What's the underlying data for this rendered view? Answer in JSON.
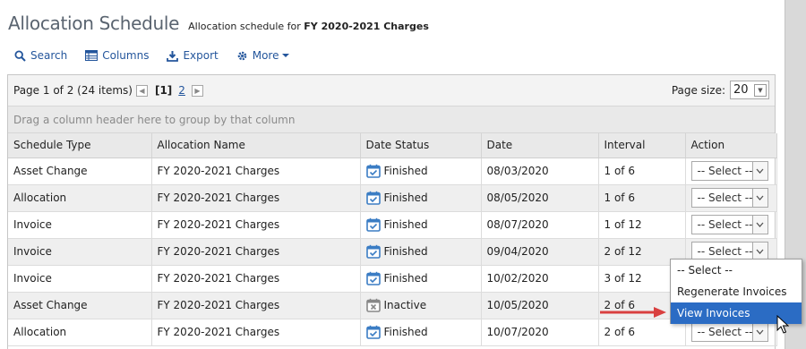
{
  "header": {
    "title": "Allocation Schedule",
    "subtitle_prefix": "Allocation schedule for",
    "subtitle_bold": "FY 2020-2021 Charges"
  },
  "toolbar": {
    "search": "Search",
    "columns": "Columns",
    "export": "Export",
    "more": "More"
  },
  "pager": {
    "info": "Page 1 of 2 (24 items)",
    "current": "[1]",
    "next": "2",
    "page_size_label": "Page size:",
    "page_size": "20"
  },
  "group_panel_text": "Drag a column header here to group by that column",
  "columns": [
    "Schedule Type",
    "Allocation Name",
    "Date Status",
    "Date",
    "Interval",
    "Action"
  ],
  "rows": [
    {
      "type": "Asset Change",
      "name": "FY 2020-2021 Charges",
      "status": "Finished",
      "status_icon": "calendar-check-icon",
      "date": "08/03/2020",
      "interval": "1 of 6",
      "action": "-- Select --"
    },
    {
      "type": "Allocation",
      "name": "FY 2020-2021 Charges",
      "status": "Finished",
      "status_icon": "calendar-check-icon",
      "date": "08/05/2020",
      "interval": "1 of 6",
      "action": "-- Select --"
    },
    {
      "type": "Invoice",
      "name": "FY 2020-2021 Charges",
      "status": "Finished",
      "status_icon": "calendar-check-icon",
      "date": "08/07/2020",
      "interval": "1 of 12",
      "action": "-- Select --"
    },
    {
      "type": "Invoice",
      "name": "FY 2020-2021 Charges",
      "status": "Finished",
      "status_icon": "calendar-check-icon",
      "date": "09/04/2020",
      "interval": "2 of 12",
      "action": "-- Select --"
    },
    {
      "type": "Invoice",
      "name": "FY 2020-2021 Charges",
      "status": "Finished",
      "status_icon": "calendar-check-icon",
      "date": "10/02/2020",
      "interval": "3 of 12",
      "action": "-- Select --"
    },
    {
      "type": "Asset Change",
      "name": "FY 2020-2021 Charges",
      "status": "Inactive",
      "status_icon": "calendar-x-icon",
      "date": "10/05/2020",
      "interval": "2 of 6",
      "action": "-- Select --"
    },
    {
      "type": "Allocation",
      "name": "FY 2020-2021 Charges",
      "status": "Finished",
      "status_icon": "calendar-check-icon",
      "date": "10/07/2020",
      "interval": "2 of 6",
      "action": "-- Select --"
    }
  ],
  "dropdown": {
    "options": [
      "-- Select --",
      "Regenerate Invoices",
      "View Invoices"
    ],
    "highlighted": "View Invoices"
  },
  "colors": {
    "link": "#24569c",
    "highlight": "#2b6cc4",
    "annotation_arrow": "#d94040",
    "calendar_icon": "#3b7dc4"
  }
}
